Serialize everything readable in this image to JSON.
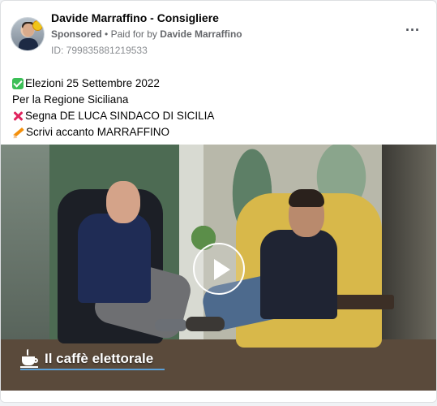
{
  "post": {
    "author": "Davide Marraffino - Consigliere",
    "sponsored_label": "Sponsored",
    "separator": "•",
    "paid_for_prefix": "Paid for by",
    "paid_for_name": "Davide Marraffino",
    "id_label": "ID: 799835881219533",
    "menu_icon": "more-horizontal-icon"
  },
  "body": {
    "line1": "Elezioni 25 Settembre 2022",
    "line2": "Per la Regione Siciliana",
    "line3": "Segna DE LUCA SINDACO DI SICILIA",
    "line4": "Scrivi accanto MARRAFFINO"
  },
  "video": {
    "caption": "Il caffè elettorale",
    "play_icon": "play-icon"
  },
  "colors": {
    "accent_underline": "#5aa0d8",
    "check": "#3cbf57",
    "cross": "#e0245e"
  }
}
